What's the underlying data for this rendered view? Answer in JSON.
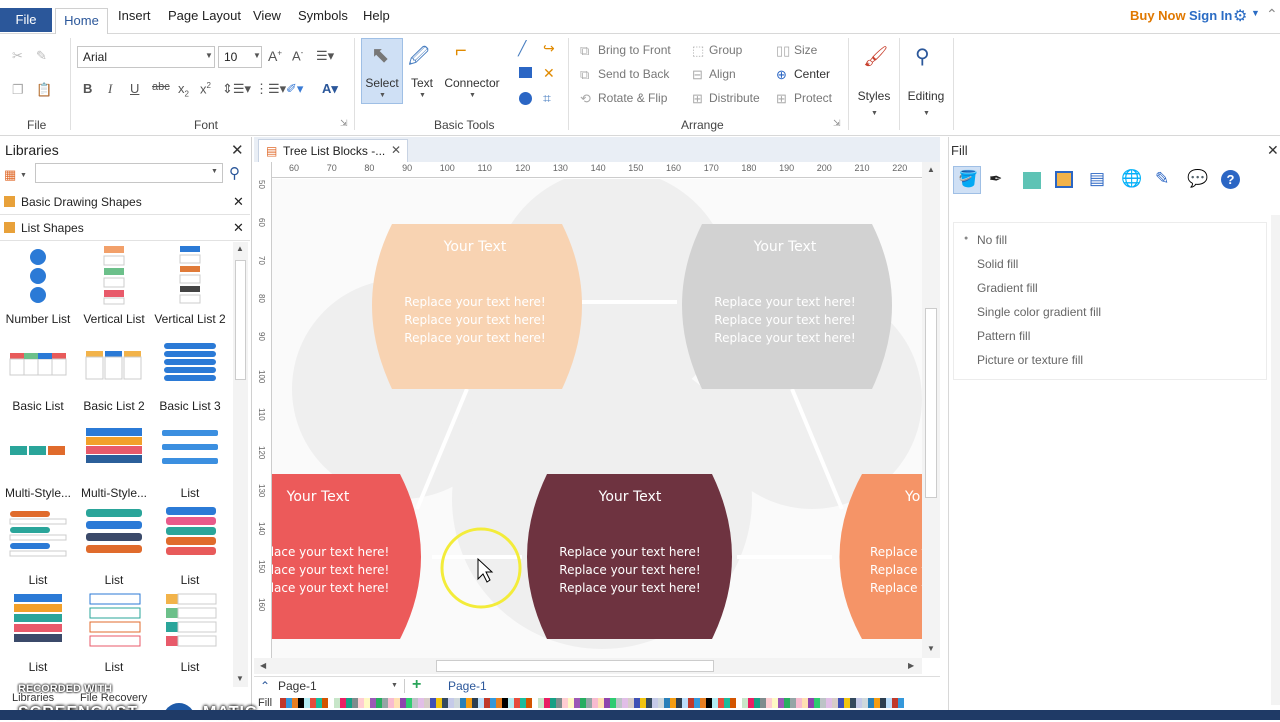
{
  "menubar": {
    "file": "File",
    "tabs": [
      "Home",
      "Insert",
      "Page Layout",
      "View",
      "Symbols",
      "Help"
    ],
    "buy_now": "Buy Now",
    "sign_in": "Sign In"
  },
  "ribbon": {
    "groups": {
      "file": "File",
      "font": "Font",
      "basic_tools": "Basic Tools",
      "arrange": "Arrange"
    },
    "font_family": "Arial",
    "font_size": "10",
    "select": "Select",
    "text": "Text",
    "connector": "Connector",
    "bring_to_front": "Bring to Front",
    "send_to_back": "Send to Back",
    "rotate_flip": "Rotate & Flip",
    "group": "Group",
    "align": "Align",
    "distribute": "Distribute",
    "size": "Size",
    "center": "Center",
    "protect": "Protect",
    "styles": "Styles",
    "editing": "Editing"
  },
  "libraries": {
    "title": "Libraries",
    "sections": [
      "Basic Drawing Shapes",
      "List Shapes"
    ],
    "shapes": [
      "Number List",
      "Vertical List",
      "Vertical List 2",
      "Basic List",
      "Basic List 2",
      "Basic List 3",
      "Multi-Style...",
      "Multi-Style...",
      "List",
      "List",
      "List",
      "List",
      "List",
      "List",
      "List"
    ],
    "bottom_tabs": [
      "Libraries",
      "File Recovery"
    ]
  },
  "document": {
    "tab_title": "Tree List Blocks -...",
    "ruler_marks": [
      "60",
      "70",
      "80",
      "90",
      "100",
      "110",
      "120",
      "130",
      "140",
      "150",
      "160",
      "170",
      "180",
      "190",
      "200",
      "210",
      "220"
    ],
    "ruler_left_marks": [
      "50",
      "60",
      "70",
      "80",
      "90",
      "100",
      "110",
      "120",
      "130",
      "140",
      "150",
      "160"
    ],
    "blocks": [
      {
        "title": "Your Text",
        "line1": "Replace your text here!",
        "line2": "Replace your text here!",
        "line3": "Replace your text here!",
        "color": "#f8d3b2"
      },
      {
        "title": "Your Text",
        "line1": "Replace your text here!",
        "line2": "Replace your text here!",
        "line3": "Replace your text here!",
        "color": "#d2d2d2"
      },
      {
        "title": "Your Text",
        "line1": "lace your text here!",
        "line2": "lace your text here!",
        "line3": "lace your text here!",
        "color": "#ec5a5a"
      },
      {
        "title": "Your Text",
        "line1": "Replace your text here!",
        "line2": "Replace your text here!",
        "line3": "Replace your text here!",
        "color": "#6e3340"
      },
      {
        "title": "Yo",
        "line1": "Replace v",
        "line2": "Replace v",
        "line3": "Replace v",
        "color": "#f59467"
      }
    ]
  },
  "pagebar": {
    "page_select": "Page-1",
    "active_page": "Page-1",
    "fill_label": "Fill"
  },
  "fill_panel": {
    "title": "Fill",
    "options": [
      "No fill",
      "Solid fill",
      "Gradient fill",
      "Single color gradient fill",
      "Pattern fill",
      "Picture or texture fill"
    ]
  },
  "watermark": {
    "line1": "RECORDED WITH",
    "line2": "SCREENCAST",
    "line3": "MATIC"
  },
  "colors": {
    "accent": "#2b579a",
    "buy_now": "#e07800",
    "sign_in": "#2b6cc4"
  }
}
